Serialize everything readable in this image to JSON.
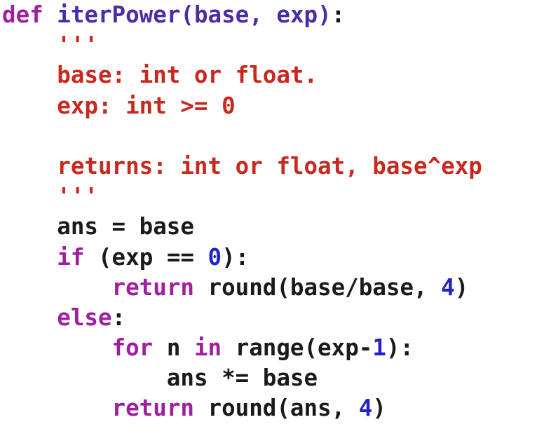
{
  "code": {
    "lines": [
      [
        {
          "t": "def ",
          "c": "kw"
        },
        {
          "t": "iterPower",
          "c": "fn"
        },
        {
          "t": "(",
          "c": "fn"
        },
        {
          "t": "base",
          "c": "fn"
        },
        {
          "t": ", ",
          "c": "fn"
        },
        {
          "t": "exp",
          "c": "fn"
        },
        {
          "t": ")",
          "c": "fn"
        },
        {
          "t": ":",
          "c": "plain"
        }
      ],
      [
        {
          "t": "    '''",
          "c": "str"
        }
      ],
      [
        {
          "t": "    base: int or float.",
          "c": "str"
        }
      ],
      [
        {
          "t": "    exp: int >= 0",
          "c": "str"
        }
      ],
      [
        {
          "t": "",
          "c": "str"
        }
      ],
      [
        {
          "t": "    returns: int or float, base^exp",
          "c": "str"
        }
      ],
      [
        {
          "t": "    '''",
          "c": "str"
        }
      ],
      [
        {
          "t": "    ans = base",
          "c": "plain"
        }
      ],
      [
        {
          "t": "    ",
          "c": "plain"
        },
        {
          "t": "if",
          "c": "kw"
        },
        {
          "t": " (exp == ",
          "c": "plain"
        },
        {
          "t": "0",
          "c": "num"
        },
        {
          "t": "):",
          "c": "plain"
        }
      ],
      [
        {
          "t": "        ",
          "c": "plain"
        },
        {
          "t": "return",
          "c": "kw"
        },
        {
          "t": " round(base/base, ",
          "c": "plain"
        },
        {
          "t": "4",
          "c": "num"
        },
        {
          "t": ")",
          "c": "plain"
        }
      ],
      [
        {
          "t": "    ",
          "c": "plain"
        },
        {
          "t": "else",
          "c": "kw"
        },
        {
          "t": ":",
          "c": "plain"
        }
      ],
      [
        {
          "t": "        ",
          "c": "plain"
        },
        {
          "t": "for",
          "c": "kw"
        },
        {
          "t": " n ",
          "c": "plain"
        },
        {
          "t": "in",
          "c": "kw"
        },
        {
          "t": " range(exp-",
          "c": "plain"
        },
        {
          "t": "1",
          "c": "num"
        },
        {
          "t": "):",
          "c": "plain"
        }
      ],
      [
        {
          "t": "            ans *= base",
          "c": "plain"
        }
      ],
      [
        {
          "t": "        ",
          "c": "plain"
        },
        {
          "t": "return",
          "c": "kw"
        },
        {
          "t": " round(ans, ",
          "c": "plain"
        },
        {
          "t": "4",
          "c": "num"
        },
        {
          "t": ")",
          "c": "plain"
        }
      ]
    ]
  }
}
